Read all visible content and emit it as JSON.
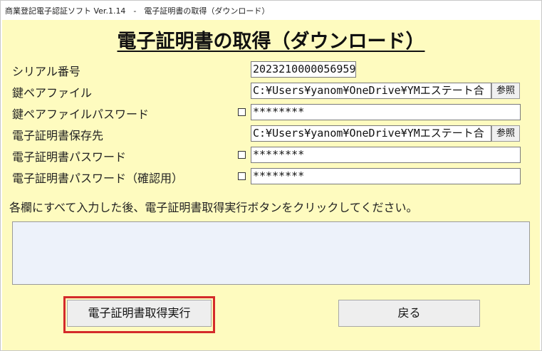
{
  "window": {
    "title": "商業登記電子認証ソフト Ver.1.14　-　電子証明書の取得（ダウンロード）"
  },
  "heading": "電子証明書の取得（ダウンロード）",
  "form": {
    "serial": {
      "label": "シリアル番号",
      "value": "2023210000056959"
    },
    "keypair_file": {
      "label": "鍵ペアファイル",
      "value": "C:¥Users¥yanom¥OneDrive¥YMエステート合",
      "browse_label": "参照"
    },
    "keypair_password": {
      "label": "鍵ペアファイルパスワード",
      "value": "********"
    },
    "cert_save_dest": {
      "label": "電子証明書保存先",
      "value": "C:¥Users¥yanom¥OneDrive¥YMエステート合",
      "browse_label": "参照"
    },
    "cert_password": {
      "label": "電子証明書パスワード",
      "value": "********"
    },
    "cert_password_confirm": {
      "label": "電子証明書パスワード（確認用）",
      "value": "********"
    }
  },
  "instruction": "各欄にすべて入力した後、電子証明書取得実行ボタンをクリックしてください。",
  "buttons": {
    "execute": "電子証明書取得実行",
    "back": "戻る"
  },
  "colors": {
    "background": "#fefbbf",
    "highlight": "#d42a2a",
    "message_box": "#edf2fa"
  }
}
